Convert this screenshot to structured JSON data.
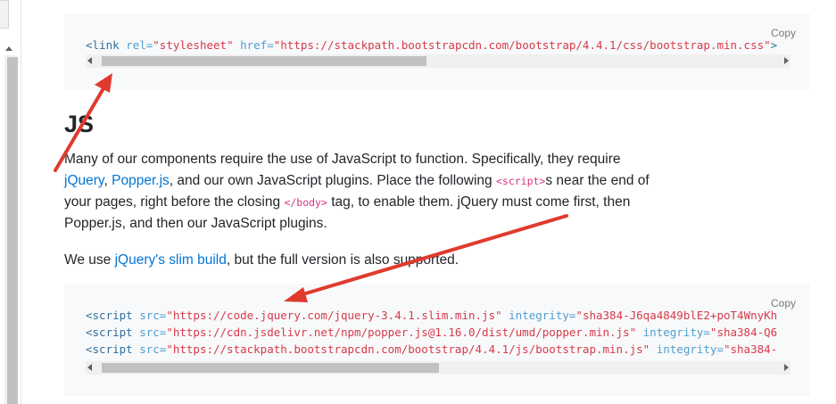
{
  "colors": {
    "accent_link": "#0075d4",
    "tag": "#2f6f9f",
    "attr": "#4f9fcf",
    "string": "#d73a49",
    "inline_code": "#d63384",
    "arrow": "#e03a2f",
    "code_bg": "#f8f9fa"
  },
  "css_block": {
    "copy_label": "Copy",
    "line1": {
      "open": "<link",
      "rel_attr": " rel=",
      "rel_val": "\"stylesheet\"",
      "href_attr": " href=",
      "href_val": "\"https://stackpath.bootstrapcdn.com/bootstrap/4.4.1/css/bootstrap.min.css\"",
      "close": ">"
    }
  },
  "js_section": {
    "heading": "JS",
    "p1": {
      "t1": "Many of our components require the use of JavaScript to function. Specifically, they require ",
      "link_jquery": "jQuery",
      "t2": ", ",
      "link_popper": "Popper.js",
      "t3": ", and our own JavaScript plugins. Place the following ",
      "code_script": "<script>",
      "t4": "s near the end of your pages, right before the closing ",
      "code_body": "</body>",
      "t5": " tag, to enable them. jQuery must come first, then Popper.js, and then our JavaScript plugins."
    },
    "p2": {
      "t1": "We use ",
      "link_slim": "jQuery's slim build",
      "t2": ", but the full version is also supported."
    }
  },
  "scripts_block": {
    "copy_label": "Copy",
    "lines": [
      {
        "open": "<script",
        "src_attr": " src=",
        "src_val": "\"https://code.jquery.com/jquery-3.4.1.slim.min.js\"",
        "int_attr": " integrity=",
        "int_val": "\"sha384-J6qa4849blE2+poT4WnyKh"
      },
      {
        "open": "<script",
        "src_attr": " src=",
        "src_val": "\"https://cdn.jsdelivr.net/npm/popper.js@1.16.0/dist/umd/popper.min.js\"",
        "int_attr": " integrity=",
        "int_val": "\"sha384-Q6"
      },
      {
        "open": "<script",
        "src_attr": " src=",
        "src_val": "\"https://stackpath.bootstrapcdn.com/bootstrap/4.4.1/js/bootstrap.min.js\"",
        "int_attr": " integrity=",
        "int_val": "\"sha384-"
      }
    ]
  }
}
